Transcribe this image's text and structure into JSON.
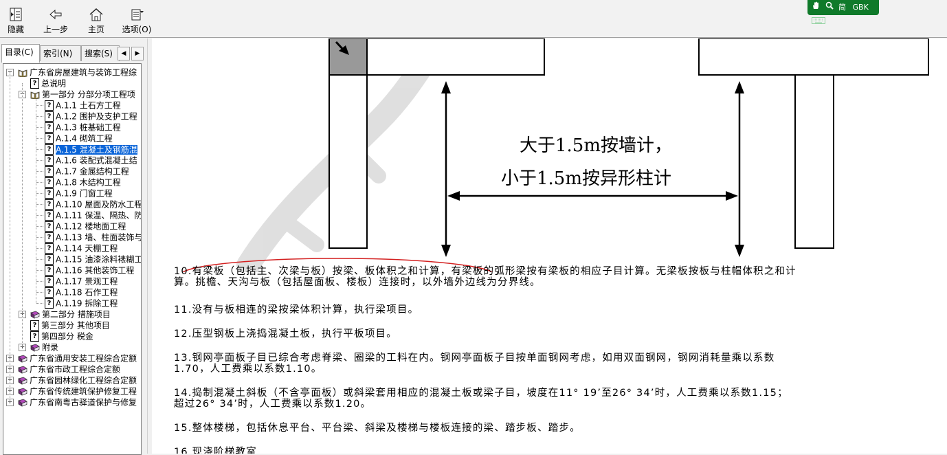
{
  "toolbar": {
    "hide": "隐藏",
    "back": "上一步",
    "home": "主页",
    "options": "选项(O)"
  },
  "ime": {
    "mode": "简",
    "encoding": "GBK"
  },
  "tabs": {
    "contents": "目录(C)",
    "index": "索引(N)",
    "search": "搜索(S)"
  },
  "tree": [
    {
      "label": "广东省房屋建筑与装饰工程综",
      "level": 0,
      "icon": "open-book",
      "expander": "minus"
    },
    {
      "label": "总说明",
      "level": 1,
      "icon": "help"
    },
    {
      "label": "第一部分 分部分项工程项",
      "level": 1,
      "icon": "open-book",
      "expander": "minus"
    },
    {
      "label": "A.1.1 土石方工程",
      "level": 2,
      "icon": "help"
    },
    {
      "label": "A.1.2 围护及支护工程",
      "level": 2,
      "icon": "help"
    },
    {
      "label": "A.1.3 桩基础工程",
      "level": 2,
      "icon": "help"
    },
    {
      "label": "A.1.4 砌筑工程",
      "level": 2,
      "icon": "help"
    },
    {
      "label": "A.1.5 混凝土及钢筋混",
      "level": 2,
      "icon": "help",
      "selected": true
    },
    {
      "label": "A.1.6 装配式混凝土结",
      "level": 2,
      "icon": "help"
    },
    {
      "label": "A.1.7 金属结构工程",
      "level": 2,
      "icon": "help"
    },
    {
      "label": "A.1.8 木结构工程",
      "level": 2,
      "icon": "help"
    },
    {
      "label": "A.1.9 门窗工程",
      "level": 2,
      "icon": "help"
    },
    {
      "label": "A.1.10 屋面及防水工程",
      "level": 2,
      "icon": "help"
    },
    {
      "label": "A.1.11 保温、隔热、防",
      "level": 2,
      "icon": "help"
    },
    {
      "label": "A.1.12 楼地面工程",
      "level": 2,
      "icon": "help"
    },
    {
      "label": "A.1.13 墙、柱面装饰与",
      "level": 2,
      "icon": "help"
    },
    {
      "label": "A.1.14 天棚工程",
      "level": 2,
      "icon": "help"
    },
    {
      "label": "A.1.15 油漆涂料裱糊工",
      "level": 2,
      "icon": "help"
    },
    {
      "label": "A.1.16 其他装饰工程",
      "level": 2,
      "icon": "help"
    },
    {
      "label": "A.1.17 景观工程",
      "level": 2,
      "icon": "help"
    },
    {
      "label": "A.1.18 石作工程",
      "level": 2,
      "icon": "help"
    },
    {
      "label": "A.1.19 拆除工程",
      "level": 2,
      "icon": "help"
    },
    {
      "label": "第二部分 措施项目",
      "level": 1,
      "icon": "book",
      "expander": "plus"
    },
    {
      "label": "第三部分 其他项目",
      "level": 1,
      "icon": "help"
    },
    {
      "label": "第四部分 税金",
      "level": 1,
      "icon": "help"
    },
    {
      "label": "附录",
      "level": 1,
      "icon": "book",
      "expander": "plus"
    },
    {
      "label": "广东省通用安装工程综合定额",
      "level": 0,
      "icon": "book",
      "expander": "plus"
    },
    {
      "label": "广东省市政工程综合定额",
      "level": 0,
      "icon": "book",
      "expander": "plus"
    },
    {
      "label": "广东省园林绿化工程综合定额",
      "level": 0,
      "icon": "book",
      "expander": "plus"
    },
    {
      "label": "广东省传统建筑保护修复工程",
      "level": 0,
      "icon": "book",
      "expander": "plus"
    },
    {
      "label": "广东省南粤古驿道保护与修复",
      "level": 0,
      "icon": "book",
      "expander": "plus"
    }
  ],
  "diagram": {
    "line1": "大于1.5m按墙计，",
    "line2": "小于1.5m按异形柱计"
  },
  "paragraphs": [
    {
      "lines": [
        "10.有梁板（包括主、次梁与板）按梁、板体积之和计算，有梁板的弧形梁按有梁板的相应子目计算。无梁板按板与柱帽体积之和计",
        "算。挑檐、天沟与板（包括屋面板、楼板）连接时，以外墙外边线为分界线。"
      ]
    },
    {
      "lines": [
        "11.没有与板相连的梁按梁体积计算，执行梁项目。"
      ]
    },
    {
      "lines": [
        "12.压型钢板上浇捣混凝土板，执行平板项目。"
      ]
    },
    {
      "lines": [
        "13.钢网亭面板子目已综合考虑脊梁、圈梁的工料在内。钢网亭面板子目按单面钢网考虑，如用双面钢网，钢网消耗量乘以系数",
        "1.70，人工费乘以系数1.10。"
      ]
    },
    {
      "lines": [
        "14.捣制混凝土斜板（不含亭面板）或斜梁套用相应的混凝土板或梁子目，坡度在11° 19’至26° 34’时，人工费乘以系数1.15；",
        "超过26° 34’时，人工费乘以系数1.20。"
      ]
    },
    {
      "lines": [
        "15.整体楼梯，包括休息平台、平台梁、斜梁及楼梯与楼板连接的梁、踏步板、踏步。"
      ]
    },
    {
      "lines": [
        "16.现浇阶梯教室"
      ]
    }
  ],
  "colors": {
    "selection": "#0a64d8",
    "annotation": "#d32020",
    "ime": "#0f7a2a"
  }
}
